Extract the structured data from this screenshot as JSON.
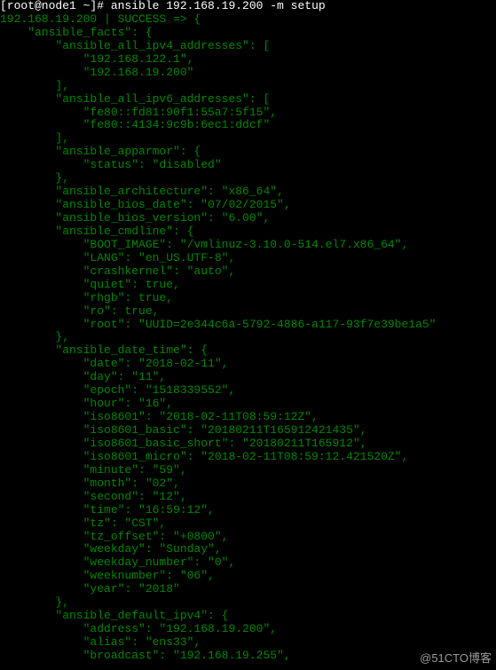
{
  "prompt": "[root@node1 ~]# ",
  "command": "ansible 192.168.19.200 -m setup",
  "result_header": {
    "host": "192.168.19.200",
    "separator": " | ",
    "status": "SUCCESS",
    "arrow": " => ",
    "brace": "{"
  },
  "json_lines": [
    "    \"ansible_facts\": {",
    "        \"ansible_all_ipv4_addresses\": [",
    "            \"192.168.122.1\",",
    "            \"192.168.19.200\"",
    "        ],",
    "        \"ansible_all_ipv6_addresses\": [",
    "            \"fe80::fd81:90f1:55a7:5f15\",",
    "            \"fe80::4134:9c9b:6ec1:ddcf\"",
    "        ],",
    "        \"ansible_apparmor\": {",
    "            \"status\": \"disabled\"",
    "        },",
    "        \"ansible_architecture\": \"x86_64\",",
    "        \"ansible_bios_date\": \"07/02/2015\",",
    "        \"ansible_bios_version\": \"6.00\",",
    "        \"ansible_cmdline\": {",
    "            \"BOOT_IMAGE\": \"/vmlinuz-3.10.0-514.el7.x86_64\",",
    "            \"LANG\": \"en_US.UTF-8\",",
    "            \"crashkernel\": \"auto\",",
    "            \"quiet\": true,",
    "            \"rhgb\": true,",
    "            \"ro\": true,",
    "            \"root\": \"UUID=2e344c6a-5792-4886-a117-93f7e39be1a5\"",
    "        },",
    "        \"ansible_date_time\": {",
    "            \"date\": \"2018-02-11\",",
    "            \"day\": \"11\",",
    "            \"epoch\": \"1518339552\",",
    "            \"hour\": \"16\",",
    "            \"iso8601\": \"2018-02-11T08:59:12Z\",",
    "            \"iso8601_basic\": \"20180211T165912421435\",",
    "            \"iso8601_basic_short\": \"20180211T165912\",",
    "            \"iso8601_micro\": \"2018-02-11T08:59:12.421520Z\",",
    "            \"minute\": \"59\",",
    "            \"month\": \"02\",",
    "            \"second\": \"12\",",
    "            \"time\": \"16:59:12\",",
    "            \"tz\": \"CST\",",
    "            \"tz_offset\": \"+0800\",",
    "            \"weekday\": \"Sunday\",",
    "            \"weekday_number\": \"0\",",
    "            \"weeknumber\": \"06\",",
    "            \"year\": \"2018\"",
    "        },",
    "        \"ansible_default_ipv4\": {",
    "            \"address\": \"192.168.19.200\",",
    "            \"alias\": \"ens33\",",
    "            \"broadcast\": \"192.168.19.255\","
  ],
  "watermark": "@51CTO博客"
}
